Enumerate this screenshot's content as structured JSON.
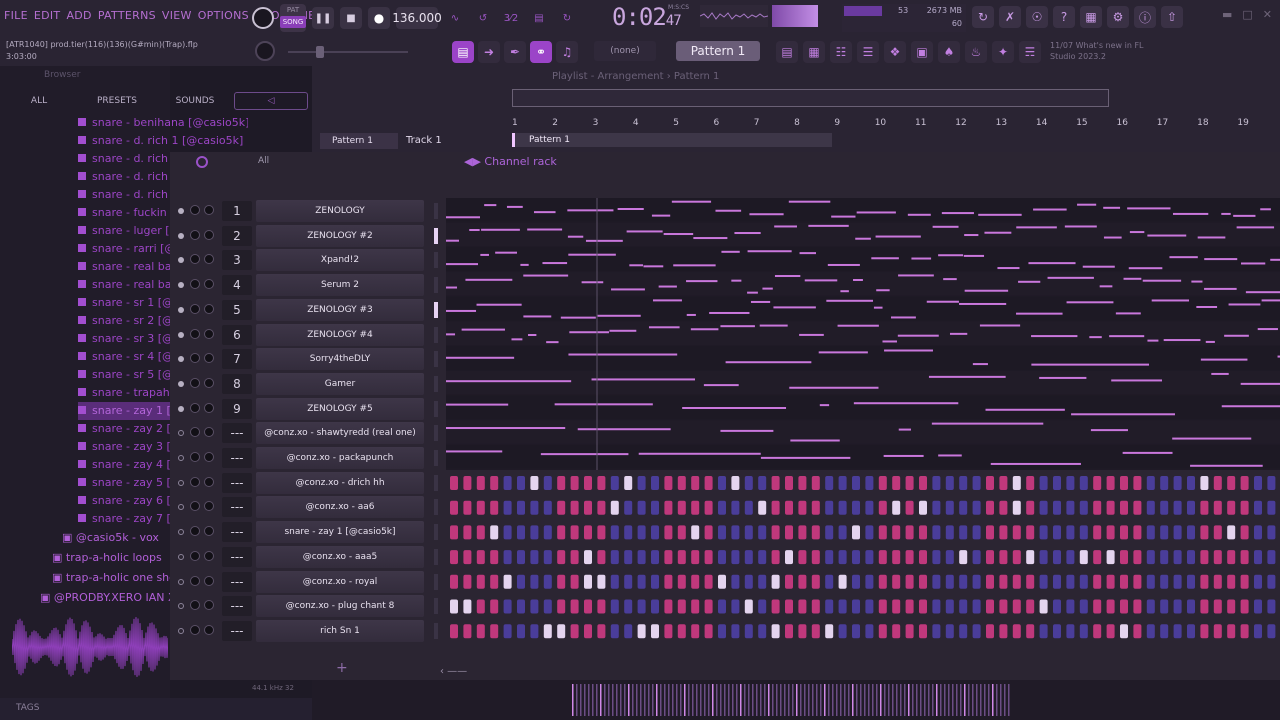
{
  "menu": [
    "FILE",
    "EDIT",
    "ADD",
    "PATTERNS",
    "VIEW",
    "OPTIONS",
    "TOOLS",
    "HELP"
  ],
  "transport": {
    "pat_label": "PAT",
    "song_label": "SONG",
    "tempo": "136.000",
    "time": "0:02",
    "time_ticks": "47",
    "time_sub": "M:S:CS"
  },
  "cpu": {
    "cpu_value": "53",
    "memory": "2673 MB",
    "polyphony": "60"
  },
  "project": {
    "name": "[ATR1040] prod.tier(116)(136)(G#min)(Trap).flp",
    "time": "3:03:00"
  },
  "toolbar": {
    "none_label": "(none)",
    "pattern_label": "Pattern 1"
  },
  "news": {
    "line1": "11/07  What's new in FL",
    "line2": "Studio 2023.2"
  },
  "browser": {
    "title": "Browser",
    "tabs": [
      "ALL",
      "PRESETS",
      "SOUNDS"
    ],
    "files": [
      "snare - benihana [@casio5k]",
      "snare - d. rich 1 [@casio5k]",
      "snare - d. rich 2",
      "snare - d. rich 3",
      "snare - d. rich 4",
      "snare - fuckin w",
      "snare - luger [@",
      "snare - rarri [@",
      "snare - real bas",
      "snare - real bas",
      "snare - sr 1 [@c",
      "snare - sr 2 [@c",
      "snare - sr 3 [@c",
      "snare - sr 4 [@c",
      "snare - sr 5 [@c",
      "snare - trapaho",
      "snare - zay 1 [",
      "snare - zay 2 [@",
      "snare - zay 3 [@",
      "snare - zay 4 [@",
      "snare - zay 5 [@",
      "snare - zay 6 [@",
      "snare - zay 7 [@"
    ],
    "selected_index": 16,
    "folders": [
      "@casio5k - vox",
      "trap-a-holic loops",
      "trap-a-holic one sho",
      "@PRODBY.XERO IAN X SX"
    ],
    "sample_info": "44.1 kHz 32",
    "tags_label": "TAGS"
  },
  "playlist": {
    "title": "Playlist - Arrangement › Pattern 1",
    "bar_numbers": [
      "1",
      "2",
      "3",
      "4",
      "5",
      "6",
      "7",
      "8",
      "9",
      "10",
      "11",
      "12",
      "13",
      "14",
      "15",
      "16",
      "17",
      "18",
      "19"
    ],
    "pattern_label": "Pattern 1",
    "track_label": "Track 1",
    "clip_label": "Pattern 1"
  },
  "rack": {
    "filter": "All",
    "title": "Channel rack",
    "channels": [
      {
        "num": "1",
        "name": "ZENOLOGY",
        "active": true,
        "selected": false,
        "type": "piano"
      },
      {
        "num": "2",
        "name": "ZENOLOGY #2",
        "active": true,
        "selected": true,
        "type": "piano"
      },
      {
        "num": "3",
        "name": "Xpand!2",
        "active": true,
        "selected": false,
        "type": "piano"
      },
      {
        "num": "4",
        "name": "Serum 2",
        "active": true,
        "selected": false,
        "type": "piano"
      },
      {
        "num": "5",
        "name": "ZENOLOGY #3",
        "active": true,
        "selected": true,
        "type": "piano"
      },
      {
        "num": "6",
        "name": "ZENOLOGY #4",
        "active": true,
        "selected": false,
        "type": "piano"
      },
      {
        "num": "7",
        "name": "Sorry4theDLY",
        "active": true,
        "selected": false,
        "type": "piano"
      },
      {
        "num": "8",
        "name": "Gamer",
        "active": true,
        "selected": false,
        "type": "piano"
      },
      {
        "num": "9",
        "name": "ZENOLOGY #5",
        "active": true,
        "selected": false,
        "type": "piano"
      },
      {
        "num": "---",
        "name": "@conz.xo - shawtyredd (real one)",
        "active": false,
        "selected": false,
        "type": "piano"
      },
      {
        "num": "---",
        "name": "@conz.xo - packapunch",
        "active": false,
        "selected": false,
        "type": "piano"
      },
      {
        "num": "---",
        "name": "@conz.xo - drich hh",
        "active": false,
        "selected": false,
        "type": "steps"
      },
      {
        "num": "---",
        "name": "@conz.xo - aa6",
        "active": false,
        "selected": false,
        "type": "steps"
      },
      {
        "num": "---",
        "name": "snare - zay 1 [@casio5k]",
        "active": false,
        "selected": false,
        "type": "steps"
      },
      {
        "num": "---",
        "name": "@conz.xo - aaa5",
        "active": false,
        "selected": false,
        "type": "steps"
      },
      {
        "num": "---",
        "name": "@conz.xo - royal",
        "active": false,
        "selected": false,
        "type": "steps"
      },
      {
        "num": "---",
        "name": "@conz.xo - plug chant 8",
        "active": false,
        "selected": false,
        "type": "steps"
      },
      {
        "num": "---",
        "name": "rich Sn 1",
        "active": false,
        "selected": false,
        "type": "steps"
      }
    ]
  },
  "colors": {
    "accent": "#b44fe0",
    "note": "#c977dc",
    "step_pink": "#c0387c",
    "step_blue": "#4a3d9a",
    "step_lit": "#e4d4ef"
  }
}
